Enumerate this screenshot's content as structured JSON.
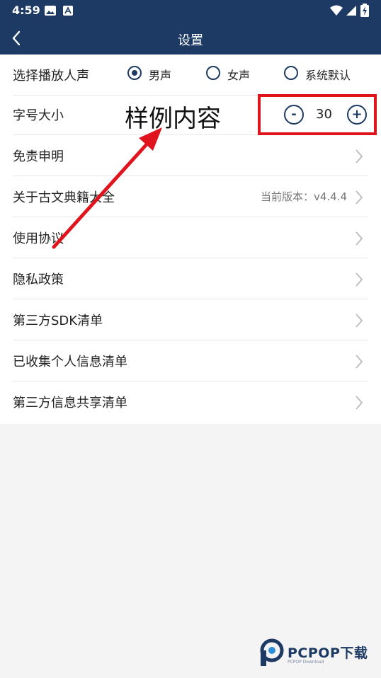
{
  "status_bar": {
    "time": "4:59"
  },
  "nav": {
    "title": "设置"
  },
  "voice": {
    "label": "选择播放人声",
    "options": [
      {
        "label": "男声",
        "selected": true
      },
      {
        "label": "女声",
        "selected": false
      },
      {
        "label": "系统默认",
        "selected": false
      }
    ]
  },
  "font_size": {
    "label": "字号大小",
    "minus": "-",
    "value": "30",
    "plus": "+"
  },
  "annotation": {
    "text": "样例内容"
  },
  "items": {
    "disclaimer": "免责申明",
    "about": "关于古文典籍大全",
    "version": "当前版本：v4.4.4",
    "agreement": "使用协议",
    "privacy": "隐私政策",
    "sdk_list": "第三方SDK清单",
    "personal_info": "已收集个人信息清单",
    "share_list": "第三方信息共享清单"
  },
  "watermark": {
    "text": "PCPOP下载",
    "sub": "PCPOP Download"
  },
  "colors": {
    "primary": "#1c3a63",
    "highlight": "#e0141c"
  }
}
